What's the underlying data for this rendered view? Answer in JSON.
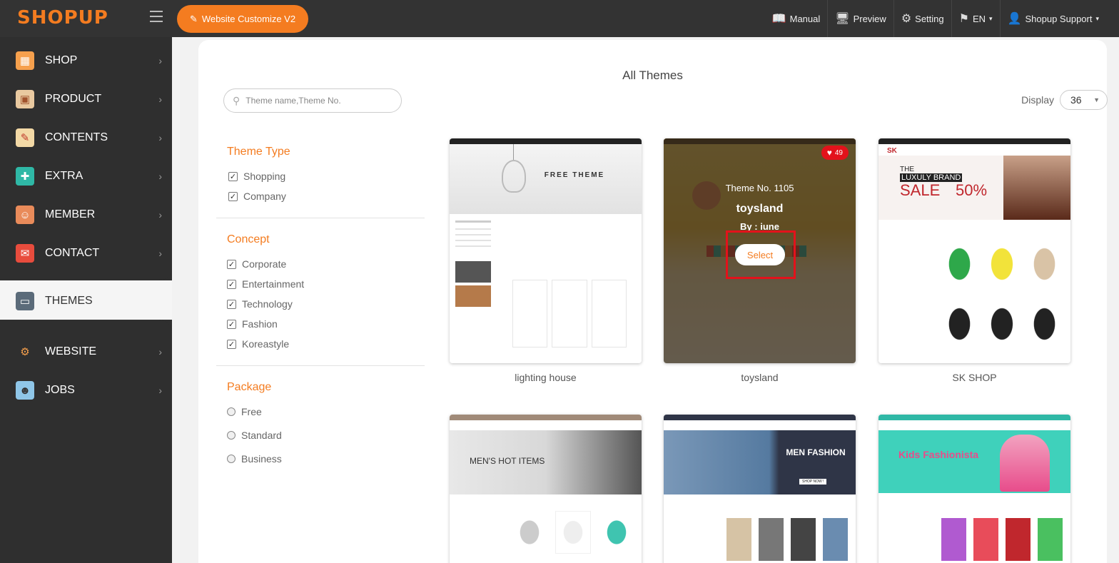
{
  "header": {
    "logo": "SHOPUP",
    "customize_label": "Website Customize V2",
    "nav": [
      {
        "icon": "book-icon",
        "label": "Manual"
      },
      {
        "icon": "monitor-icon",
        "label": "Preview"
      },
      {
        "icon": "gear-icon",
        "label": "Setting"
      },
      {
        "icon": "flag-icon",
        "label": "EN"
      },
      {
        "icon": "user-icon",
        "label": "Shopup Support"
      }
    ]
  },
  "sidebar": {
    "items": [
      {
        "label": "SHOP",
        "icon": "shop-icon"
      },
      {
        "label": "PRODUCT",
        "icon": "shopping-bag-icon"
      },
      {
        "label": "CONTENTS",
        "icon": "document-icon"
      },
      {
        "label": "EXTRA",
        "icon": "puzzle-icon"
      },
      {
        "label": "MEMBER",
        "icon": "members-icon"
      },
      {
        "label": "CONTACT",
        "icon": "mail-phone-icon"
      },
      {
        "label": "THEMES",
        "icon": "monitor-icon"
      },
      {
        "label": "WEBSITE",
        "icon": "gears-icon"
      },
      {
        "label": "JOBS",
        "icon": "job-icon"
      }
    ],
    "active": "THEMES"
  },
  "main": {
    "title": "All Themes",
    "search_placeholder": "Theme name,Theme No.",
    "display_label": "Display",
    "display_value": "36",
    "filters": {
      "theme_type": {
        "title": "Theme Type",
        "options": [
          "Shopping",
          "Company"
        ]
      },
      "concept": {
        "title": "Concept",
        "options": [
          "Corporate",
          "Entertainment",
          "Technology",
          "Fashion",
          "Koreastyle"
        ]
      },
      "package": {
        "title": "Package",
        "options": [
          "Free",
          "Standard",
          "Business"
        ]
      }
    },
    "themes": [
      {
        "name": "lighting house",
        "thumb_text": "FREE THEME"
      },
      {
        "name": "toysland",
        "theme_no": "Theme No. 1105",
        "title": "toysland",
        "by": "By : iune",
        "likes": "49",
        "select_label": "Select"
      },
      {
        "name": "SK SHOP",
        "thumb_text_1": "THE",
        "thumb_text_2": "LUXULY BRAND",
        "thumb_text_3": "SALE",
        "thumb_text_4": "50%"
      },
      {
        "name": "",
        "thumb_text": "MEN'S HOT ITEMS"
      },
      {
        "name": "",
        "thumb_text": "MEN FASHION",
        "thumb_btn": "SHOP NOW !"
      },
      {
        "name": "",
        "thumb_text": "Kids Fashionista"
      }
    ]
  },
  "colors": {
    "accent": "#f47c20",
    "highlight": "#e3121b",
    "sidebar": "#2f2f2f",
    "topbar": "#333333"
  }
}
